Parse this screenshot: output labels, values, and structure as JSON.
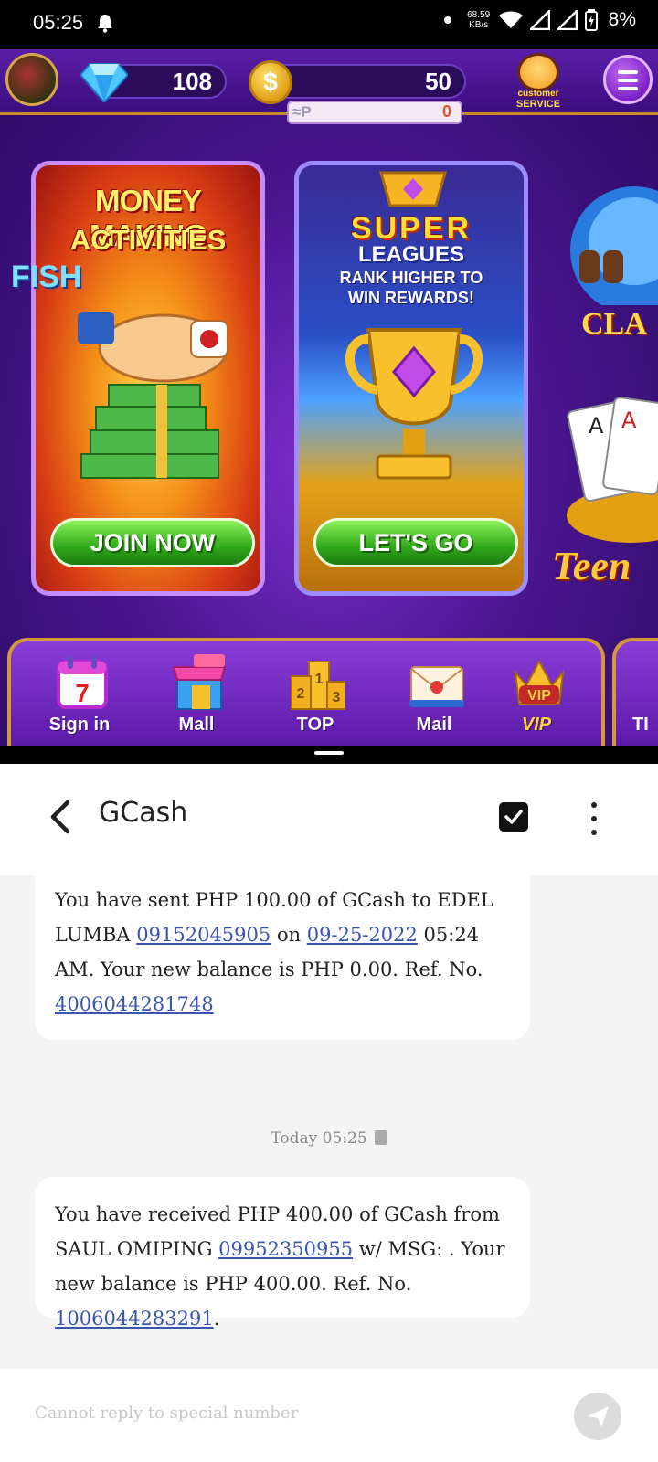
{
  "status_bar": {
    "time": "05:25",
    "net_speed_value": "68.59",
    "net_speed_unit": "KB/s",
    "battery": "8%"
  },
  "game": {
    "gems": "108",
    "coins": "50",
    "points": "0",
    "points_icon": "≈P",
    "customer_service_label_1": "customer",
    "customer_service_label_2": "SERVICE",
    "cards": {
      "money": {
        "title_1": "MONEY MAKING",
        "title_2": "ACTIVITIES",
        "button": "JOIN NOW"
      },
      "leagues": {
        "title_1": "SUPER",
        "title_2": "LEAGUES",
        "subtitle": "RANK HIGHER TO WIN REWARDS!",
        "button": "LET'S GO"
      },
      "side": {
        "text_1": "CLA",
        "text_2": "FISH",
        "teen": "Teen"
      }
    },
    "nav": [
      {
        "label": "Sign in",
        "icon": "calendar-icon",
        "badge": "7"
      },
      {
        "label": "Mall",
        "icon": "shop-icon",
        "badge": "SHOP"
      },
      {
        "label": "TOP",
        "icon": "podium-icon"
      },
      {
        "label": "Mail",
        "icon": "envelope-icon"
      },
      {
        "label": "VIP",
        "icon": "crown-icon"
      }
    ],
    "nav_edge_label": "TI"
  },
  "messages": {
    "title": "GCash",
    "conversation": [
      {
        "pre_1": "You have sent PHP 100.00 of GCash to EDEL LUMBA ",
        "phone": "09152045905",
        "mid": " on ",
        "date": "09-25-2022",
        "post": " 05:24 AM. Your new balance is PHP 0.00. Ref. No. ",
        "ref": "4006044281748",
        "end": ""
      },
      {
        "pre_1": "You have received PHP 400.00 of GCash from SAUL OMIPING ",
        "phone": "09952350955",
        "mid": " w/ MSG: . Your new balance is PHP 400.00. Ref. No. ",
        "ref": "1006044283291",
        "end": "."
      }
    ],
    "timestamp": "Today 05:25",
    "composer_placeholder": "Cannot reply to special number"
  },
  "colors": {
    "link": "#3a55b0",
    "game_bg": "#4a1690",
    "gold": "#d39a3a"
  }
}
